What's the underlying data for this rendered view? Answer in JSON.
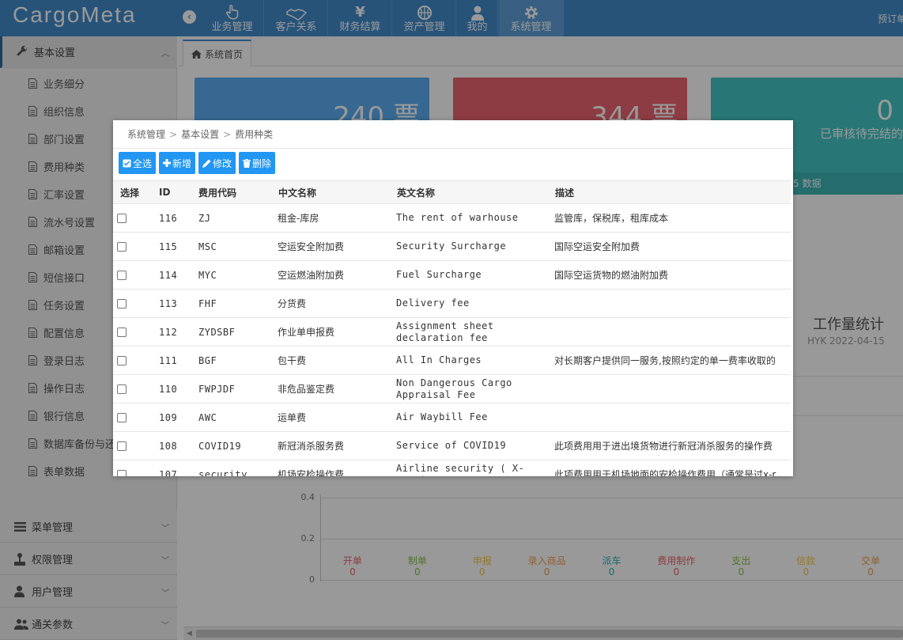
{
  "app": {
    "logo": "CargoMeta",
    "top_right": "预订单"
  },
  "nav": [
    {
      "label": "业务管理",
      "icon": "hand-pointer-icon"
    },
    {
      "label": "客户关系",
      "icon": "handshake-icon"
    },
    {
      "label": "财务结算",
      "icon": "yen-icon"
    },
    {
      "label": "资产管理",
      "icon": "basketball-icon"
    },
    {
      "label": "我的",
      "icon": "user-icon"
    },
    {
      "label": "系统管理",
      "icon": "gear-icon",
      "active": true
    }
  ],
  "sidebar": {
    "basic": {
      "title": "基本设置",
      "icon": "wrench-icon"
    },
    "items": [
      "业务细分",
      "组织信息",
      "部门设置",
      "费用种类",
      "汇率设置",
      "流水号设置",
      "邮箱设置",
      "短信接口",
      "任务设置",
      "配置信息",
      "登录日志",
      "操作日志",
      "银行信息",
      "数据库备份与还原",
      "表单数据"
    ],
    "sections": [
      {
        "title": "菜单管理",
        "icon": "list-icon"
      },
      {
        "title": "权限管理",
        "icon": "joystick-icon"
      },
      {
        "title": "用户管理",
        "icon": "user-icon"
      },
      {
        "title": "通关参数",
        "icon": "users-icon"
      }
    ]
  },
  "tab": {
    "label": "系统首页"
  },
  "cards": [
    {
      "value": "240 票",
      "subtitle": "",
      "footer": ""
    },
    {
      "value": "344 票",
      "subtitle": "",
      "footer": ""
    },
    {
      "value": "0",
      "subtitle": "已审核待完结的",
      "footer": "5 数据"
    }
  ],
  "workstats": {
    "title": "工作量统计",
    "subtitle": "HYK 2022-04-15"
  },
  "chart_data": {
    "type": "bar",
    "categories": [
      "开单",
      "制单",
      "申报",
      "录入商品",
      "派车",
      "费用制作",
      "支出",
      "信款",
      "交单"
    ],
    "values": [
      0,
      0,
      0,
      0,
      0,
      0,
      0,
      0,
      0
    ],
    "yticks": [
      "0.4",
      "0.2",
      "0"
    ],
    "ylim": [
      0,
      0.4
    ],
    "category_colors": [
      "#e9646e",
      "#8bc34a",
      "#f7c948",
      "#f0a058",
      "#2bb5b3",
      "#e9646e",
      "#8bc34a",
      "#f7c948",
      "#f0a058"
    ]
  },
  "modal": {
    "breadcrumb": [
      "系统管理",
      "基本设置",
      "费用种类"
    ],
    "toolbar": {
      "select_all": "全选",
      "add": "新增",
      "edit": "修改",
      "delete": "删除"
    },
    "columns": [
      "选择",
      "ID",
      "费用代码",
      "中文名称",
      "英文名称",
      "描述"
    ],
    "rows": [
      {
        "id": "116",
        "code": "ZJ",
        "cn": "租金-库房",
        "en": "The rent of warhouse",
        "desc": "监管库，保税库，租库成本"
      },
      {
        "id": "115",
        "code": "MSC",
        "cn": "空运安全附加费",
        "en": "Security Surcharge",
        "desc": "国际空运安全附加费"
      },
      {
        "id": "114",
        "code": "MYC",
        "cn": "空运燃油附加费",
        "en": "Fuel Surcharge",
        "desc": "国际空运货物的燃油附加费"
      },
      {
        "id": "113",
        "code": "FHF",
        "cn": "分货费",
        "en": "Delivery fee",
        "desc": ""
      },
      {
        "id": "112",
        "code": "ZYDSBF",
        "cn": "作业单申报费",
        "en": "Assignment sheet declaration fee",
        "desc": ""
      },
      {
        "id": "111",
        "code": "BGF",
        "cn": "包干费",
        "en": "All In Charges",
        "desc": "对长期客户提供同一服务,按照约定的单一费率收取的"
      },
      {
        "id": "110",
        "code": "FWPJDF",
        "cn": "非危品鉴定费",
        "en": "Non Dangerous Cargo Appraisal Fee",
        "desc": ""
      },
      {
        "id": "109",
        "code": "AWC",
        "cn": "运单费",
        "en": "Air Waybill Fee",
        "desc": ""
      },
      {
        "id": "108",
        "code": "COVID19",
        "cn": "新冠消杀服务费",
        "en": "Service of COVID19",
        "desc": "此项费用用于进出境货物进行新冠消杀服务的操作费"
      },
      {
        "id": "107",
        "code": "security",
        "cn": "机场安检操作费",
        "en": "Airline security ( X-RAY )",
        "desc": "此项费用用于机场地面的安检操作费用（通常是过x-r"
      }
    ]
  }
}
